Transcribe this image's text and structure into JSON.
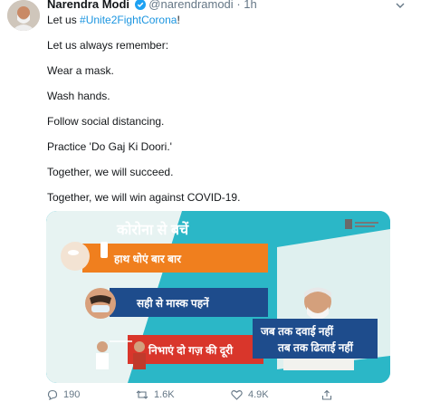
{
  "tweet": {
    "author_name": "Narendra Modi",
    "handle": "@narendramodi",
    "separator": "·",
    "time": "1h",
    "text_prefix": "Let us ",
    "hashtag": "#Unite2FightCorona",
    "text_suffix": "!",
    "lines": [
      "Let us always remember:",
      "Wear a mask.",
      "Wash hands.",
      "Follow social distancing.",
      "Practice 'Do Gaj Ki Doori.'",
      "Together, we will succeed.",
      "Together, we will win against COVID-19."
    ]
  },
  "poster": {
    "headline": "कोरोना से बचें",
    "rows": [
      "हाथ धोएं बार बार",
      "सही से मास्क पहनें",
      "निभाएं दो गज़ की दूरी"
    ],
    "slogan_line1": "जब तक दवाई नहीं",
    "slogan_line2": "तब तक ढिलाई नहीं",
    "colors": {
      "teal": "#25b3c4",
      "orange": "#f07f1e",
      "navy": "#1e4c8c",
      "red": "#d9362b"
    }
  },
  "actions": {
    "replies": "190",
    "retweets": "1.6K",
    "likes": "4.9K"
  },
  "icons": [
    "avatar",
    "verified-icon",
    "more-caret-icon",
    "reply-icon",
    "retweet-icon",
    "like-icon",
    "share-icon",
    "emblem-icon"
  ]
}
